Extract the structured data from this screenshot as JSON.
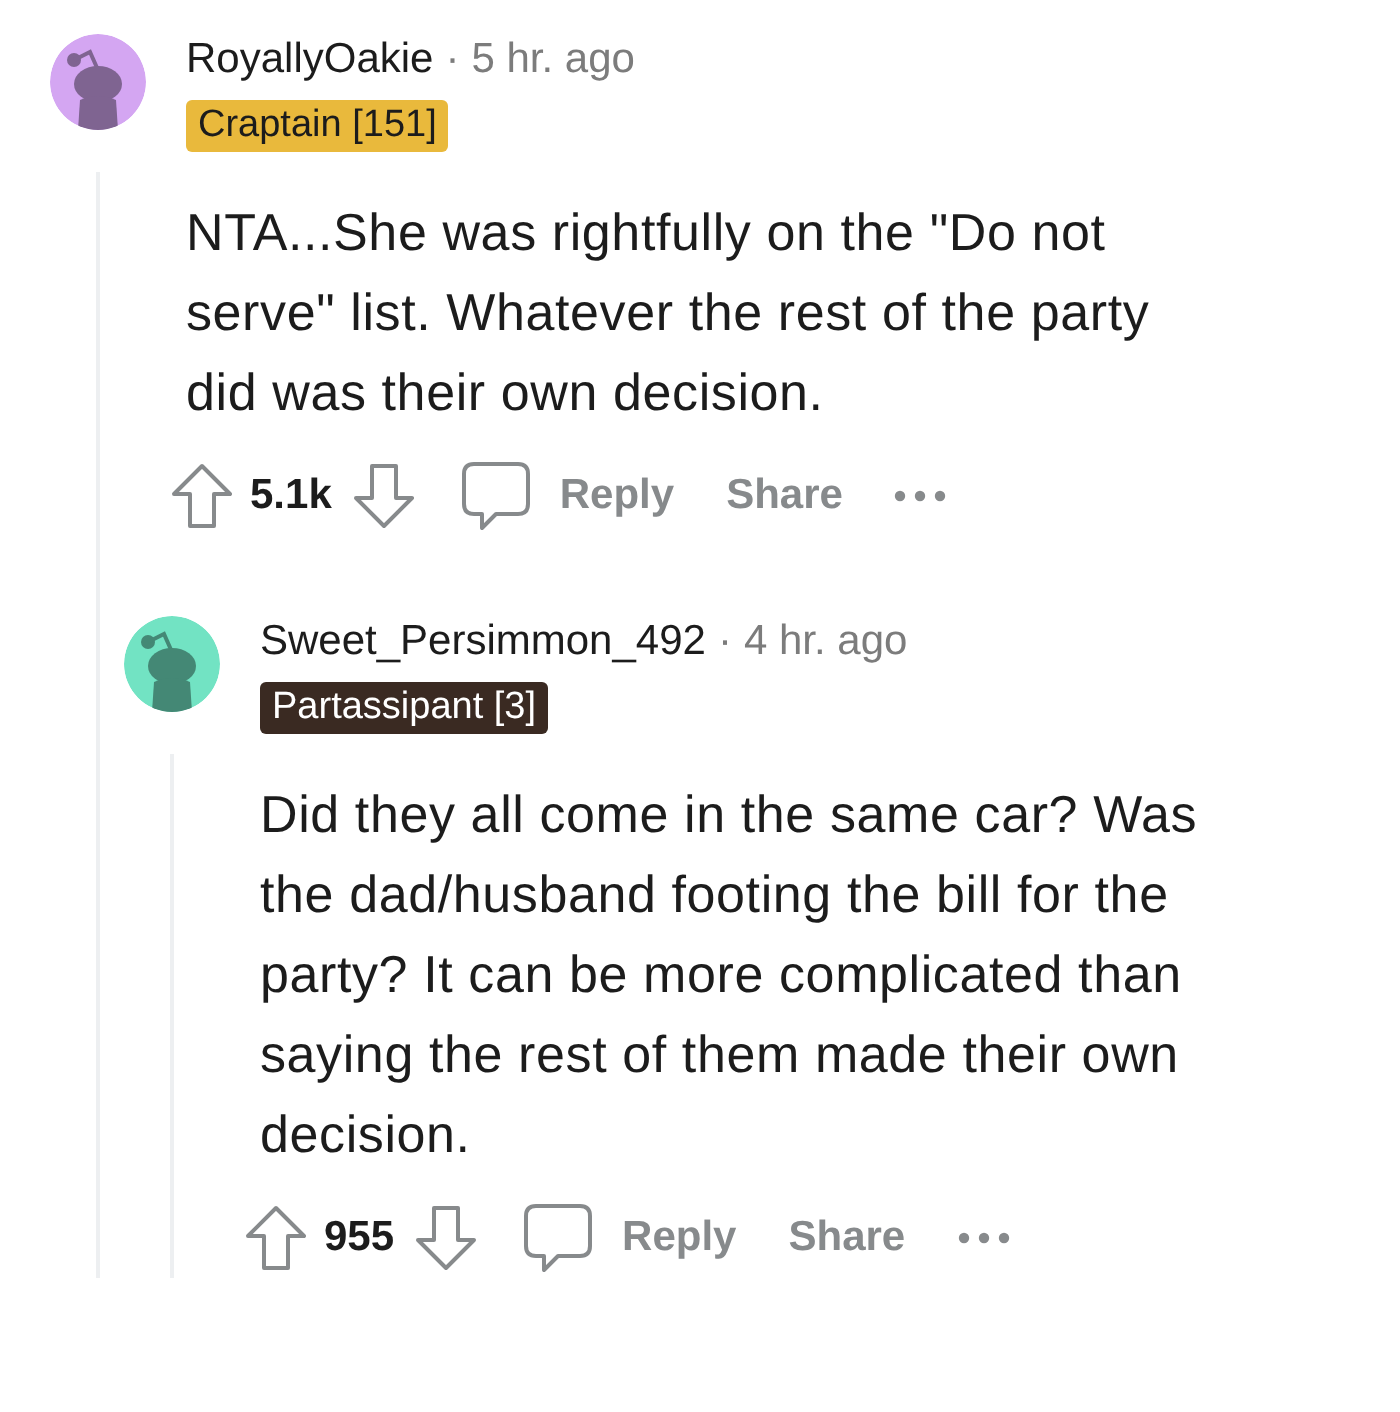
{
  "comments": [
    {
      "author": "RoyallyOakie",
      "separator": "·",
      "time": "5 hr. ago",
      "avatar": {
        "color": "#d4a6f2"
      },
      "flair": {
        "text": "Craptain [151]",
        "color": "#e9b93c"
      },
      "body": "NTA...She was rightfully on the \"Do not serve\" list. Whatever the rest of the party did was their own decision.",
      "score": "5.1k",
      "actions": [
        "Reply",
        "Share"
      ],
      "children": [
        {
          "author": "Sweet_Persimmon_492",
          "separator": "·",
          "time": "4 hr. ago",
          "avatar": {
            "color": "#72e3c3"
          },
          "flair": {
            "text": "Partassipant [3]",
            "color": "#3a2a22"
          },
          "body": "Did they all come in the same car? Was the dad/husband footing the bill for the party? It can be more complicated than saying the rest of them made their own decision.",
          "score": "955",
          "actions": [
            "Reply",
            "Share"
          ]
        }
      ]
    }
  ]
}
